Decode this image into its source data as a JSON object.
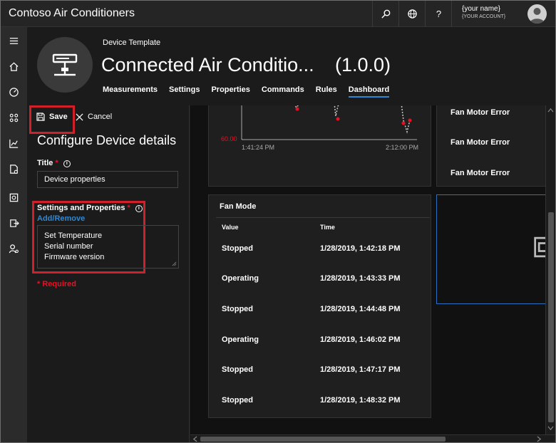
{
  "app": {
    "title": "Contoso Air Conditioners"
  },
  "topbar": {
    "user_name": "{your name}",
    "user_account": "{YOUR ACCOUNT}",
    "help_label": "?"
  },
  "header": {
    "template_label": "Device Template",
    "template_name": "Connected Air Conditio...",
    "version": "(1.0.0)",
    "tabs": [
      {
        "label": "Measurements"
      },
      {
        "label": "Settings"
      },
      {
        "label": "Properties"
      },
      {
        "label": "Commands"
      },
      {
        "label": "Rules"
      },
      {
        "label": "Dashboard",
        "active": true
      }
    ]
  },
  "config": {
    "save_label": "Save",
    "cancel_label": "Cancel",
    "heading": "Configure Device details",
    "title_label": "Title",
    "title_value": "Device properties",
    "props_label": "Settings and Properties",
    "add_remove": "Add/Remove",
    "properties": [
      "Set Temperature",
      "Serial number",
      "Firmware version"
    ],
    "required_note": "* Required",
    "required_star": "*"
  },
  "chart": {
    "y_label": "60.00",
    "x_labels": [
      "1:41:24 PM",
      "2:12:00 PM"
    ]
  },
  "fan_motor": {
    "rows": [
      "Fan Motor Error",
      "Fan Motor Error",
      "Fan Motor Error"
    ]
  },
  "fan_mode": {
    "title": "Fan Mode",
    "col_value": "Value",
    "col_time": "Time",
    "rows": [
      {
        "value": "Stopped",
        "time": "1/28/2019, 1:42:18 PM"
      },
      {
        "value": "Operating",
        "time": "1/28/2019, 1:43:33 PM"
      },
      {
        "value": "Stopped",
        "time": "1/28/2019, 1:44:48 PM"
      },
      {
        "value": "Operating",
        "time": "1/28/2019, 1:46:02 PM"
      },
      {
        "value": "Stopped",
        "time": "1/28/2019, 1:47:17 PM"
      },
      {
        "value": "Stopped",
        "time": "1/28/2019, 1:48:32 PM"
      }
    ]
  },
  "colors": {
    "accent": "#2b88d8",
    "highlight": "#d0202a",
    "required": "#e81123"
  }
}
